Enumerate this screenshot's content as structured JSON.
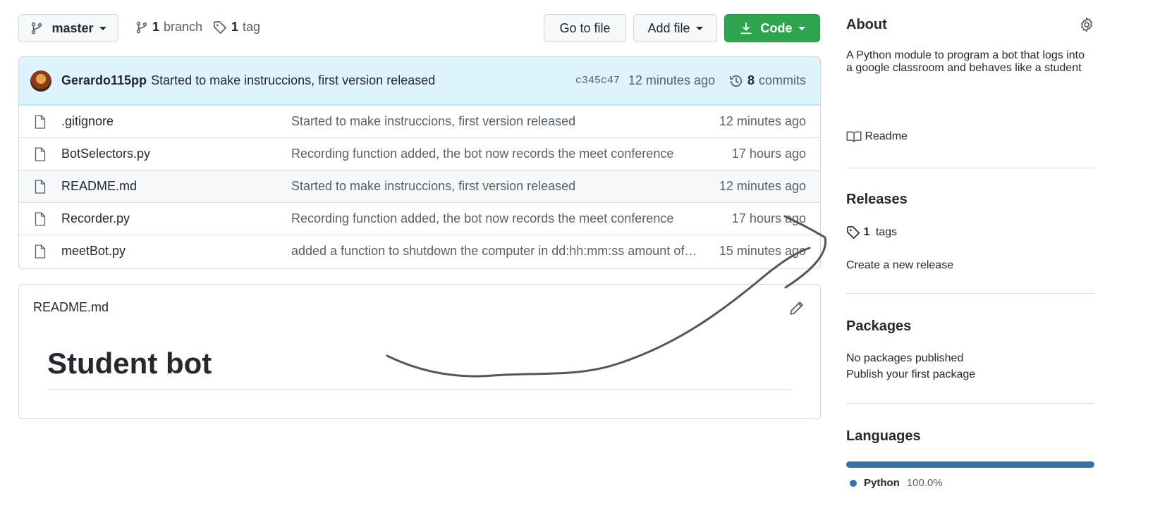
{
  "toolbar": {
    "branch_name": "master",
    "branch_count": "1",
    "branch_label": "branch",
    "tag_count": "1",
    "tag_label": "tag",
    "go_to_file": "Go to file",
    "add_file": "Add file",
    "code": "Code"
  },
  "commit": {
    "author": "Gerardo115pp",
    "message": "Started to make instruccions, first version released",
    "sha": "c345c47",
    "time": "12 minutes ago",
    "commits_count": "8",
    "commits_label": "commits"
  },
  "files": [
    {
      "name": ".gitignore",
      "message": "Started to make instruccions, first version released",
      "time": "12 minutes ago"
    },
    {
      "name": "BotSelectors.py",
      "message": "Recording function added, the bot now records the meet conference",
      "time": "17 hours ago"
    },
    {
      "name": "README.md",
      "message": "Started to make instruccions, first version released",
      "time": "12 minutes ago"
    },
    {
      "name": "Recorder.py",
      "message": "Recording function added, the bot now records the meet conference",
      "time": "17 hours ago"
    },
    {
      "name": "meetBot.py",
      "message": "added a function to shutdown the computer in dd:hh:mm:ss amount of ti...",
      "time": "15 minutes ago"
    }
  ],
  "readme": {
    "filename": "README.md",
    "title": "Student bot"
  },
  "about": {
    "heading": "About",
    "description": "A Python module to program a bot that logs into a google classroom and behaves like a student",
    "readme_label": "Readme"
  },
  "releases": {
    "heading": "Releases",
    "tag_count": "1",
    "tag_label": "tags",
    "create_link": "Create a new release"
  },
  "packages": {
    "heading": "Packages",
    "none_text": "No packages published",
    "publish_link": "Publish your first package"
  },
  "languages": {
    "heading": "Languages",
    "items": [
      {
        "name": "Python",
        "percent": "100.0%",
        "color": "#3572A5",
        "share": 1.0
      }
    ]
  },
  "colors": {
    "accent_green": "#2da44e",
    "link_blue": "#0969da",
    "commit_bar": "#ddf4ff",
    "annotation_stroke": "#555555"
  }
}
